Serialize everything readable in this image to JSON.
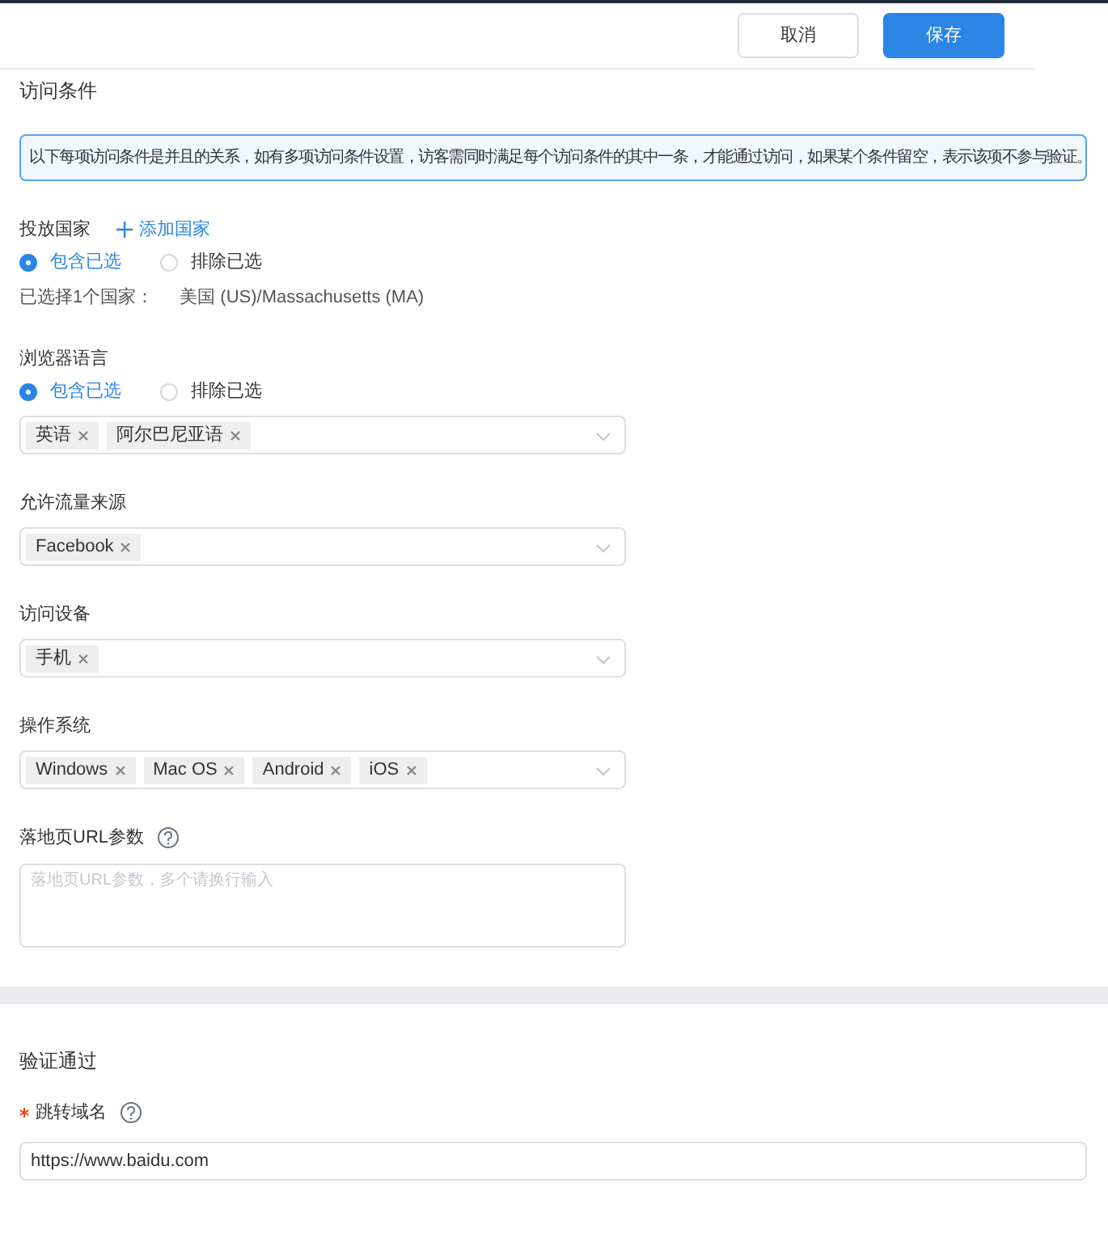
{
  "header": {
    "buttons": [
      {
        "label": "取消",
        "kind": "default"
      },
      {
        "label": "保存",
        "kind": "primary"
      }
    ]
  },
  "access": {
    "title": "访问条件",
    "notice": "以下每项访问条件是并且的关系，如有多项访问条件设置，访客需同时满足每个访问条件的其中一条，才能通过访问，如果某个条件留空，表示该项不参与验证。",
    "fields": [
      {
        "kind": "country",
        "label": "投放国家",
        "add_link": "添加国家",
        "radios": [
          {
            "label": "包含已选",
            "selected": true
          },
          {
            "label": "排除已选",
            "selected": false
          }
        ],
        "summary_label": "已选择1个国家：",
        "summary_value": "美国 (US)/Massachusetts (MA)"
      },
      {
        "kind": "select",
        "label": "浏览器语言",
        "radios": [
          {
            "label": "包含已选",
            "selected": true
          },
          {
            "label": "排除已选",
            "selected": false
          }
        ],
        "tags": [
          "英语",
          "阿尔巴尼亚语"
        ]
      },
      {
        "kind": "select",
        "label": "允许流量来源",
        "tags": [
          "Facebook"
        ]
      },
      {
        "kind": "select",
        "label": "访问设备",
        "tags": [
          "手机"
        ]
      },
      {
        "kind": "select",
        "label": "操作系统",
        "tags": [
          "Windows",
          "Mac OS",
          "Android",
          "iOS"
        ]
      },
      {
        "kind": "textarea",
        "label": "落地页URL参数",
        "help": true,
        "placeholder": "落地页URL参数，多个请换行输入"
      }
    ]
  },
  "verify": {
    "title": "验证通过",
    "field": {
      "label": "跳转域名",
      "required": true,
      "help": true,
      "value": "https://www.baidu.com"
    }
  }
}
